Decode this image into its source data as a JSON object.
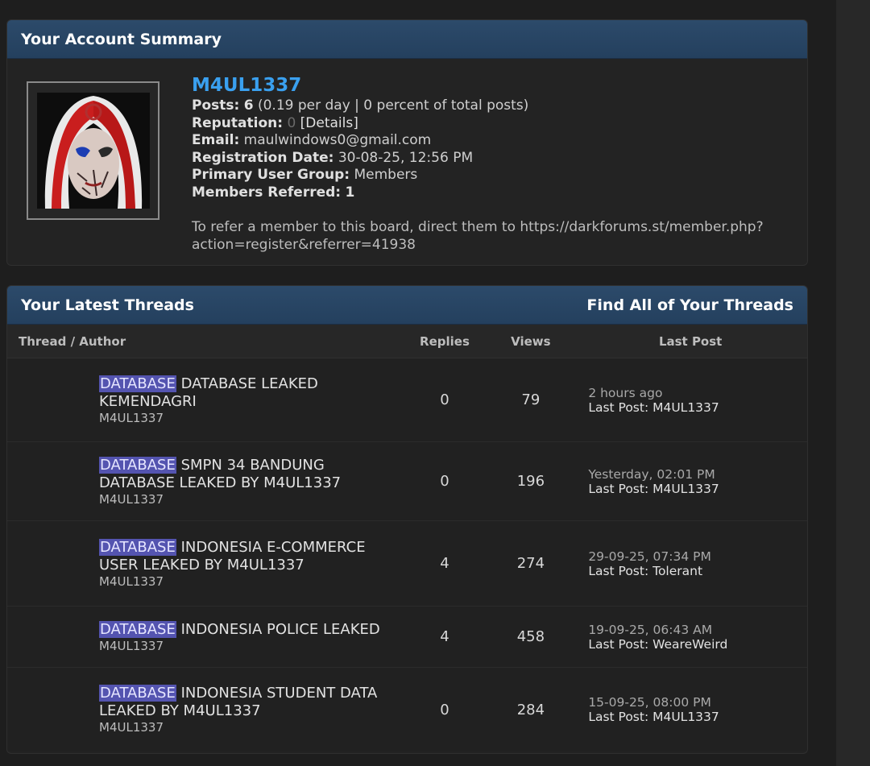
{
  "summary": {
    "title": "Your Account Summary",
    "username": "M4UL1337",
    "posts_label": "Posts:",
    "posts_value": "6",
    "posts_detail": "(0.19 per day | 0 percent of total posts)",
    "reputation_label": "Reputation:",
    "reputation_value": "0",
    "details_link": "[Details]",
    "email_label": "Email:",
    "email_value": "maulwindows0@gmail.com",
    "regdate_label": "Registration Date:",
    "regdate_value": "30-08-25, 12:56 PM",
    "group_label": "Primary User Group:",
    "group_value": "Members",
    "referred_label": "Members Referred:",
    "referred_value": "1",
    "refer_text": "To refer a member to this board, direct them to https://darkforums.st/member.php?action=register&referrer=41938"
  },
  "threads": {
    "title": "Your Latest Threads",
    "find_all": "Find All of Your Threads",
    "columns": [
      "Thread / Author",
      "Replies",
      "Views",
      "Last Post"
    ],
    "rows": [
      {
        "tag": "DATABASE",
        "title": "DATABASE LEAKED KEMENDAGRI",
        "author": "M4UL1337",
        "replies": "0",
        "views": "79",
        "last_date": "2 hours ago",
        "last_post": "Last Post: M4UL1337"
      },
      {
        "tag": "DATABASE",
        "title": "SMPN 34 BANDUNG DATABASE LEAKED BY M4UL1337",
        "author": "M4UL1337",
        "replies": "0",
        "views": "196",
        "last_date": "Yesterday, 02:01 PM",
        "last_post": "Last Post: M4UL1337"
      },
      {
        "tag": "DATABASE",
        "title": "INDONESIA E-COMMERCE USER LEAKED BY M4UL1337",
        "author": "M4UL1337",
        "replies": "4",
        "views": "274",
        "last_date": "29-09-25, 07:34 PM",
        "last_post": "Last Post: Tolerant"
      },
      {
        "tag": "DATABASE",
        "title": "INDONESIA POLICE LEAKED",
        "author": "M4UL1337",
        "replies": "4",
        "views": "458",
        "last_date": "19-09-25, 06:43 AM",
        "last_post": "Last Post: WeareWeird"
      },
      {
        "tag": "DATABASE",
        "title": "INDONESIA STUDENT DATA LEAKED BY M4UL1337",
        "author": "M4UL1337",
        "replies": "0",
        "views": "284",
        "last_date": "15-09-25, 08:00 PM",
        "last_post": "Last Post: M4UL1337"
      }
    ]
  },
  "colors": {
    "header_bg": "#2c4a6a",
    "username": "#3aa0ef",
    "tag_bg": "#5454b0",
    "page_bg": "#1e1e1e"
  }
}
